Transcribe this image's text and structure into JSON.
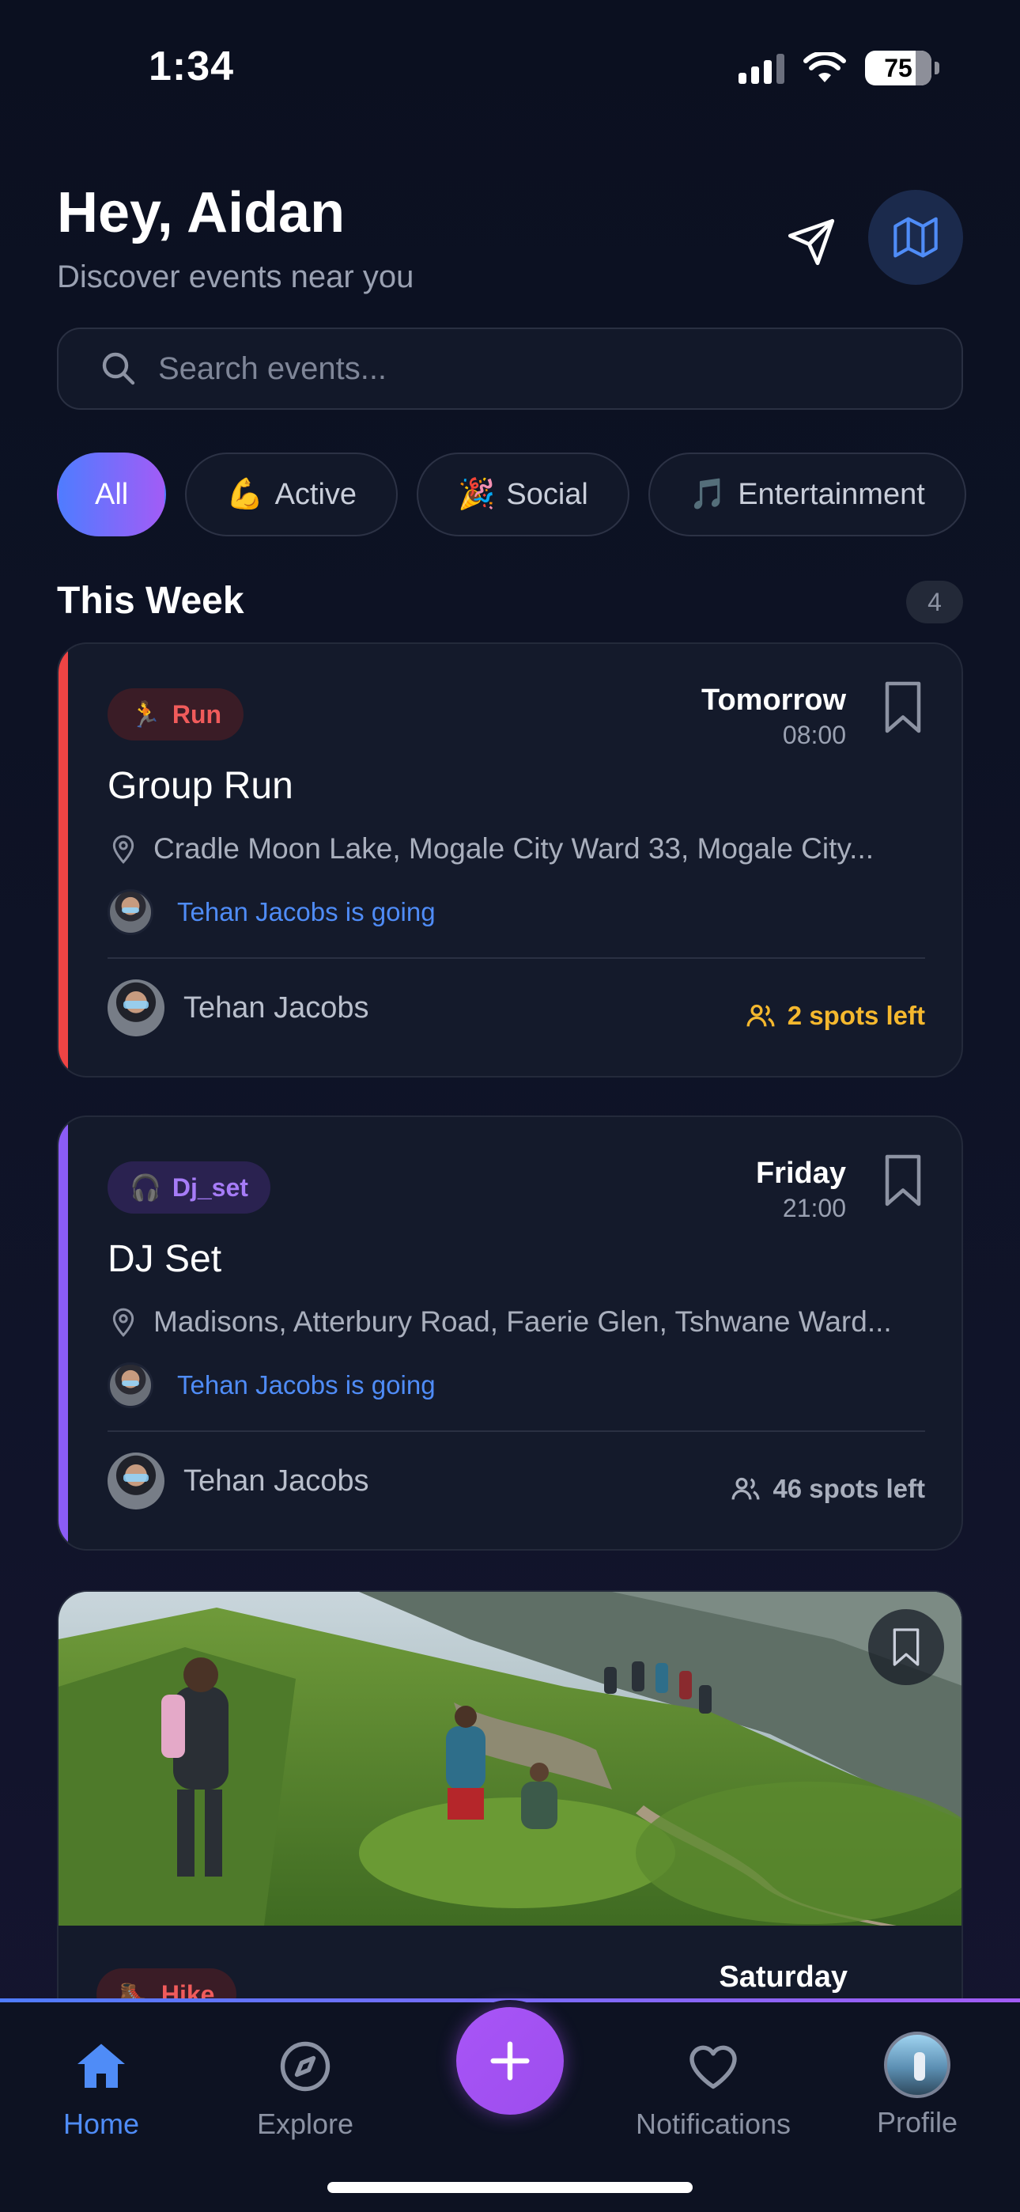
{
  "status": {
    "time": "1:34",
    "battery": "75"
  },
  "header": {
    "greeting": "Hey, Aidan",
    "subtitle": "Discover events near you"
  },
  "search": {
    "placeholder": "Search events..."
  },
  "chips": [
    {
      "label": "All",
      "emoji": ""
    },
    {
      "label": "Active",
      "emoji": "💪"
    },
    {
      "label": "Social",
      "emoji": "🎉"
    },
    {
      "label": "Entertainment",
      "emoji": "🎵"
    }
  ],
  "section": {
    "title": "This Week",
    "count": "4"
  },
  "events": [
    {
      "tag": "Run",
      "tag_emoji": "🏃",
      "day": "Tomorrow",
      "time": "08:00",
      "title": "Group Run",
      "location": "Cradle Moon Lake, Mogale City Ward 33, Mogale City...",
      "going": "Tehan Jacobs is going",
      "host": "Tehan Jacobs",
      "spots": "2 spots left",
      "accent": "#ef4444",
      "tag_bg": "#3a1c26",
      "tag_color": "#f05b5b",
      "spots_color": "#f5b82e"
    },
    {
      "tag": "Dj_set",
      "tag_emoji": "🎧",
      "day": "Friday",
      "time": "21:00",
      "title": "DJ Set",
      "location": "Madisons, Atterbury Road, Faerie Glen, Tshwane Ward...",
      "going": "Tehan Jacobs is going",
      "host": "Tehan Jacobs",
      "spots": "46 spots left",
      "accent": "#8b5cf6",
      "tag_bg": "#2a2250",
      "tag_color": "#a67cf7",
      "spots_color": "#a9afbd"
    },
    {
      "tag": "Hike",
      "tag_emoji": "🥾",
      "day": "Saturday"
    }
  ],
  "nav": {
    "home": "Home",
    "explore": "Explore",
    "notifications": "Notifications",
    "profile": "Profile"
  },
  "colors": {
    "accent_blue": "#4f8cf7",
    "accent_purple": "#a855f7",
    "background": "#0e1326"
  }
}
